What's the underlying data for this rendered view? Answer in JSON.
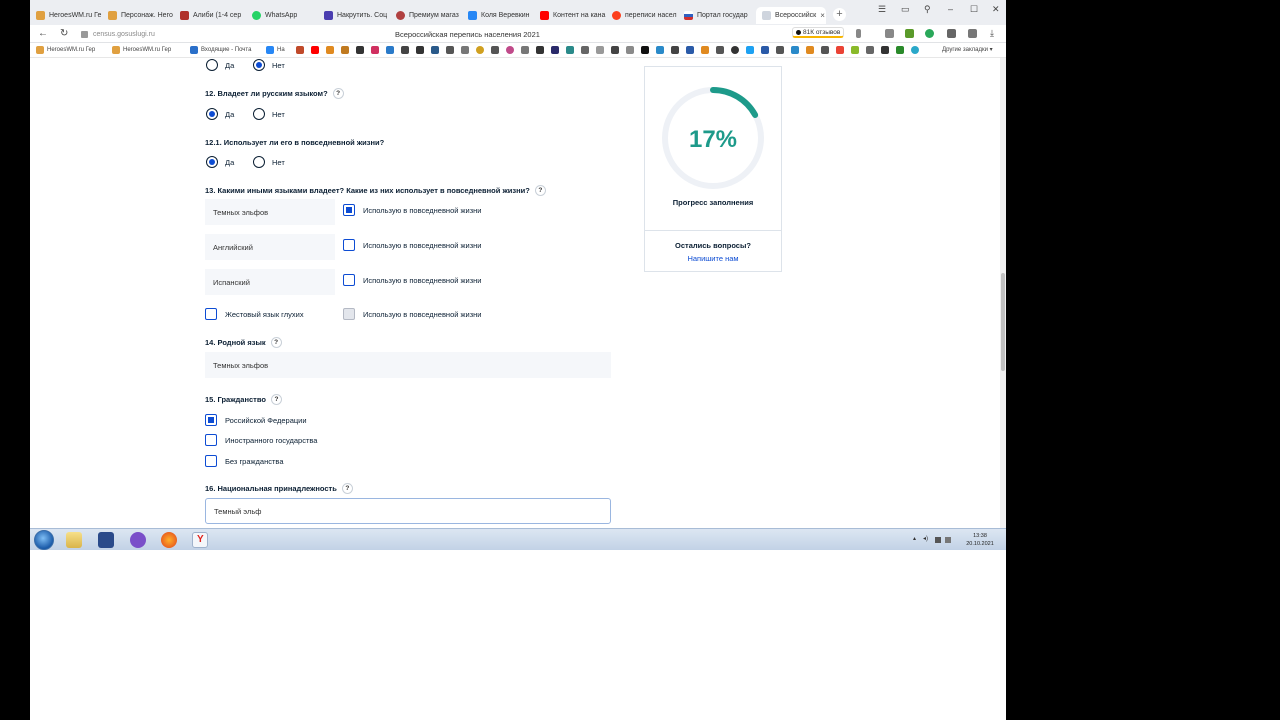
{
  "browser": {
    "tabs": [
      {
        "label": "HeroesWM.ru Ге",
        "color": "#e0a040"
      },
      {
        "label": "Персонаж. Него",
        "color": "#e0a040"
      },
      {
        "label": "Алиби (1-4 сер",
        "color": "#b0302a"
      },
      {
        "label": "WhatsApp",
        "color": "#25d366"
      },
      {
        "label": "Накрутить. Соц",
        "color": "#4a3db0"
      },
      {
        "label": "Премиум магаз",
        "color": "#b04040"
      },
      {
        "label": "Коля Веревкин",
        "color": "#2787f5"
      },
      {
        "label": "Контент на кана",
        "color": "#ff0000"
      },
      {
        "label": "переписи насел",
        "color": "#fc3f1d"
      },
      {
        "label": "Портал государ",
        "color": "#3060c0"
      },
      {
        "label": "Всероссийск",
        "color": "#cfd5de"
      }
    ],
    "tab_close": "×",
    "new_tab": "+",
    "window_controls": [
      "☰",
      "▭",
      "⚲",
      "–",
      "☐",
      "✕"
    ],
    "url": "census.gosuslugi.ru",
    "page_title": "Всероссийская перепись населения 2021",
    "reviews_badge": "81К отзывов",
    "bookmarks": [
      {
        "label": "HeroesWM.ru Гер",
        "color": "#e0a040"
      },
      {
        "label": "HeroesWM.ru Гер",
        "color": "#e0a040"
      },
      {
        "label": "Входящие - Почта",
        "color": "#2a6fc9"
      },
      {
        "label": "На",
        "color": "#2787f5"
      }
    ],
    "other_bookmarks": "Другие закладки ▾"
  },
  "form": {
    "q11_yes": "Да",
    "q11_no": "Нет",
    "q12_label": "12. Владеет ли русским языком?",
    "q12_yes": "Да",
    "q12_no": "Нет",
    "q121_label": "12.1. Использует ли его в повседневной жизни?",
    "q121_yes": "Да",
    "q121_no": "Нет",
    "q13_label": "13. Какими иными языками владеет? Какие из них использует в повседневной жизни?",
    "languages": [
      {
        "name": "Темных эльфов",
        "daily": "Использую в повседневной жизни",
        "checked": true
      },
      {
        "name": "Английский",
        "daily": "Использую в повседневной жизни",
        "checked": false
      },
      {
        "name": "Испанский",
        "daily": "Использую в повседневной жизни",
        "checked": false
      }
    ],
    "sign_language": "Жестовый язык глухих",
    "sign_daily": "Использую в повседневной жизни",
    "q14_label": "14. Родной язык",
    "q14_value": "Темных эльфов",
    "q15_label": "15. Гражданство",
    "citizenship": [
      {
        "label": "Российской Федерации",
        "checked": true
      },
      {
        "label": "Иностранного государства",
        "checked": false
      },
      {
        "label": "Без гражданства",
        "checked": false
      }
    ],
    "q16_label": "16. Национальная принадлежность",
    "q16_value": "Темный эльф",
    "help": "?"
  },
  "progress": {
    "percent_text": "17%",
    "value": 0.17,
    "label": "Прогресс заполнения",
    "questions": "Остались вопросы?",
    "write_us": "Напишите нам",
    "color": "#1d9a8a"
  },
  "taskbar": {
    "time": "13:38",
    "date": "20.10.2021"
  }
}
